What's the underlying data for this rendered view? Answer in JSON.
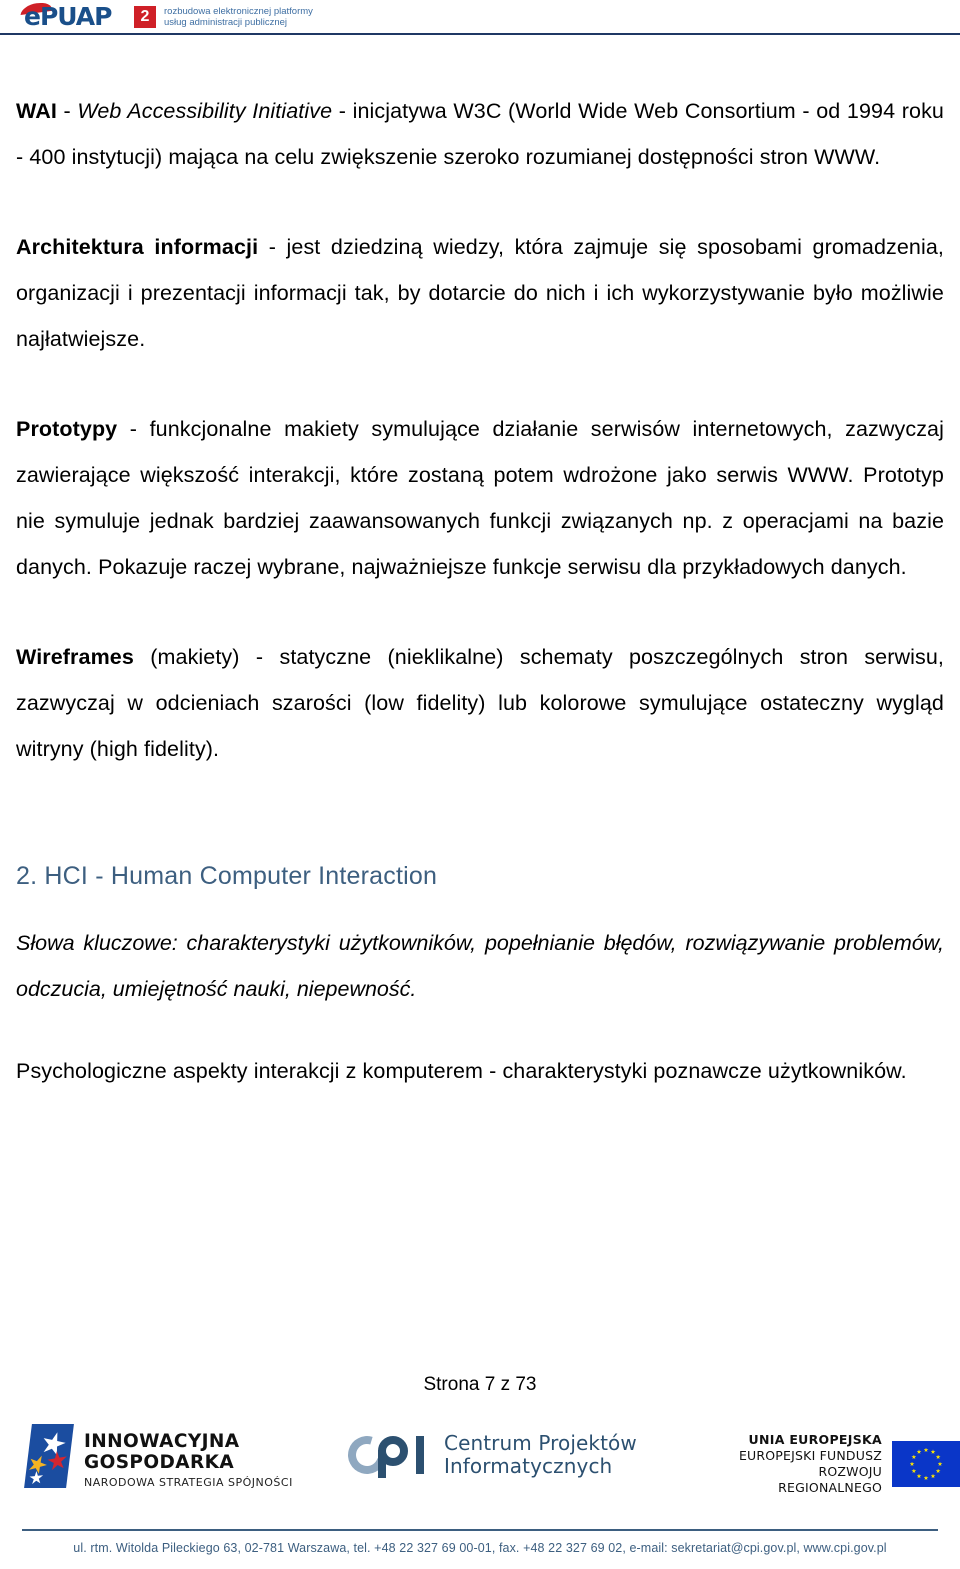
{
  "header": {
    "logo_word": "ePUAP",
    "logo_badge": "2",
    "tagline_line1": "rozbudowa elektronicznej platformy",
    "tagline_line2": "usług administracji publicznej",
    "rule_color": "#1f3864",
    "brand_blue": "#1a4f8a",
    "brand_red": "#cf2027"
  },
  "content": {
    "paragraphs": [
      {
        "lead": "WAI",
        "lead_style": "bold",
        "italic_part": "Web Accessibility Initiative",
        "rest": " -  inicjatywa W3C (World Wide Web Consortium - od 1994 roku - 400 instytucji) mająca na celu zwiększenie szeroko rozumianej dostępności stron WWW.",
        "separator": " - "
      },
      {
        "lead": "Architektura informacji",
        "rest": "  - jest dziedziną wiedzy, która zajmuje się sposobami gromadzenia, organizacji i prezentacji informacji tak, by dotarcie do nich i ich wykorzystywanie było możliwie najłatwiejsze."
      },
      {
        "lead": "Prototypy",
        "rest": " - funkcjonalne makiety symulujące działanie serwisów internetowych, zazwyczaj zawierające większość interakcji, które zostaną potem wdrożone jako serwis WWW. Prototyp nie symuluje jednak bardziej zaawansowanych funkcji związanych np. z operacjami na bazie danych. Pokazuje raczej wybrane, najważniejsze funkcje serwisu dla przykładowych danych."
      },
      {
        "lead": "Wireframes",
        "rest": " (makiety) - statyczne (nieklikalne) schematy poszczególnych stron serwisu, zazwyczaj w odcieniach szarości (low fidelity) lub kolorowe symulujące ostateczny wygląd witryny (high fidelity)."
      }
    ],
    "section_heading": "2. HCI - Human Computer Interaction",
    "section_heading_color": "#3d5f80",
    "keywords_paragraph": "Słowa kluczowe: charakterystyki użytkowników, popełnianie błędów, rozwiązywanie problemów, odczucia, umiejętność nauki, niepewność.",
    "closing_paragraph": "Psychologiczne aspekty interakcji z komputerem - charakterystyki poznawcze użytkowników."
  },
  "page_number": "Strona 7 z 73",
  "footer": {
    "logo_innowacyjna": {
      "line1": "INNOWACYJNA",
      "line2": "GOSPODARKA",
      "line3": "NARODOWA STRATEGIA SPÓJNOŚCI"
    },
    "logo_cpi": {
      "line1": "Centrum Projektów",
      "line2": "Informatycznych",
      "color": "#2c5070"
    },
    "logo_eu": {
      "line1": "UNIA EUROPEJSKA",
      "line2": "EUROPEJSKI FUNDUSZ",
      "line3": "ROZWOJU REGIONALNEGO",
      "flag_color": "#0a36c8",
      "star_color": "#ffe600"
    },
    "address": "ul. rtm. Witolda Pileckiego 63, 02-781 Warszawa, tel. +48 22 327 69 00-01, fax. +48 22 327 69 02, e-mail: sekretariat@cpi.gov.pl, www.cpi.gov.pl",
    "address_color": "#3d5f80"
  }
}
